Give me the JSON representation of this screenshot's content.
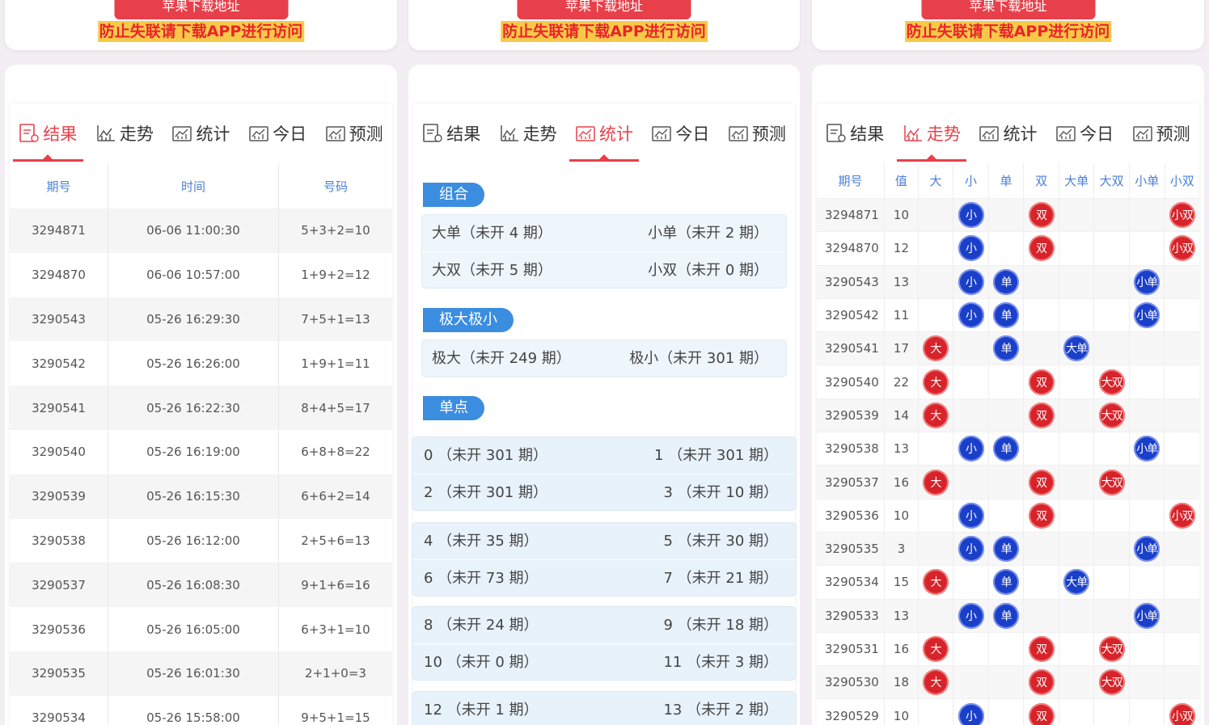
{
  "banner": {
    "apple_label": "苹果下载地址",
    "warning": "防止失联请下载APP进行访问"
  },
  "tabs": [
    "结果",
    "走势",
    "统计",
    "今日",
    "预测"
  ],
  "tab_icons": [
    "result-icon",
    "trend-chart-icon",
    "stats-chart-icon",
    "today-chart-icon",
    "predict-chart-icon"
  ],
  "results": {
    "headers": [
      "期号",
      "时间",
      "号码"
    ],
    "rows": [
      [
        "3294871",
        "06-06 11:00:30",
        "5+3+2=10"
      ],
      [
        "3294870",
        "06-06 10:57:00",
        "1+9+2=12"
      ],
      [
        "3290543",
        "05-26 16:29:30",
        "7+5+1=13"
      ],
      [
        "3290542",
        "05-26 16:26:00",
        "1+9+1=11"
      ],
      [
        "3290541",
        "05-26 16:22:30",
        "8+4+5=17"
      ],
      [
        "3290540",
        "05-26 16:19:00",
        "6+8+8=22"
      ],
      [
        "3290539",
        "05-26 16:15:30",
        "6+6+2=14"
      ],
      [
        "3290538",
        "05-26 16:12:00",
        "2+5+6=13"
      ],
      [
        "3290537",
        "05-26 16:08:30",
        "9+1+6=16"
      ],
      [
        "3290536",
        "05-26 16:05:00",
        "6+3+1=10"
      ],
      [
        "3290535",
        "05-26 16:01:30",
        "2+1+0=3"
      ],
      [
        "3290534",
        "05-26 15:58:00",
        "9+5+1=15"
      ]
    ]
  },
  "stats": {
    "combo_label": "组合",
    "combo": [
      [
        "大单（未开 4 期）",
        "小单（未开 2 期）"
      ],
      [
        "大双（未开 5 期）",
        "小双（未开 0 期）"
      ]
    ],
    "extreme_label": "极大极小",
    "extreme": [
      [
        "极大（未开 249 期）",
        "极小（未开 301 期）"
      ]
    ],
    "single_label": "单点",
    "single_groups": [
      [
        [
          "0 （未开 301 期）",
          "1 （未开 301 期）"
        ],
        [
          "2 （未开 301 期）",
          "3 （未开 10 期）"
        ]
      ],
      [
        [
          "4 （未开 35 期）",
          "5 （未开 30 期）"
        ],
        [
          "6 （未开 73 期）",
          "7 （未开 21 期）"
        ]
      ],
      [
        [
          "8 （未开 24 期）",
          "9 （未开 18 期）"
        ],
        [
          "10 （未开 0 期）",
          "11 （未开 3 期）"
        ]
      ],
      [
        [
          "12 （未开 1 期）",
          "13 （未开 2 期）"
        ]
      ]
    ]
  },
  "trend": {
    "headers": [
      "期号",
      "值",
      "大",
      "小",
      "单",
      "双",
      "大单",
      "大双",
      "小单",
      "小双"
    ],
    "colors": {
      "red": "#d8232a",
      "blue": "#1a3fc9"
    },
    "rows": [
      {
        "issue": "3294871",
        "value": "10",
        "cells": [
          "",
          "小",
          "",
          "双",
          "",
          "",
          "",
          "小双"
        ]
      },
      {
        "issue": "3294870",
        "value": "12",
        "cells": [
          "",
          "小",
          "",
          "双",
          "",
          "",
          "",
          "小双"
        ]
      },
      {
        "issue": "3290543",
        "value": "13",
        "cells": [
          "",
          "小",
          "单",
          "",
          "",
          "",
          "小单",
          ""
        ]
      },
      {
        "issue": "3290542",
        "value": "11",
        "cells": [
          "",
          "小",
          "单",
          "",
          "",
          "",
          "小单",
          ""
        ]
      },
      {
        "issue": "3290541",
        "value": "17",
        "cells": [
          "大",
          "",
          "单",
          "",
          "大单",
          "",
          "",
          ""
        ]
      },
      {
        "issue": "3290540",
        "value": "22",
        "cells": [
          "大",
          "",
          "",
          "双",
          "",
          "大双",
          "",
          ""
        ]
      },
      {
        "issue": "3290539",
        "value": "14",
        "cells": [
          "大",
          "",
          "",
          "双",
          "",
          "大双",
          "",
          ""
        ]
      },
      {
        "issue": "3290538",
        "value": "13",
        "cells": [
          "",
          "小",
          "单",
          "",
          "",
          "",
          "小单",
          ""
        ]
      },
      {
        "issue": "3290537",
        "value": "16",
        "cells": [
          "大",
          "",
          "",
          "双",
          "",
          "大双",
          "",
          ""
        ]
      },
      {
        "issue": "3290536",
        "value": "10",
        "cells": [
          "",
          "小",
          "",
          "双",
          "",
          "",
          "",
          "小双"
        ]
      },
      {
        "issue": "3290535",
        "value": "3",
        "cells": [
          "",
          "小",
          "单",
          "",
          "",
          "",
          "小单",
          ""
        ]
      },
      {
        "issue": "3290534",
        "value": "15",
        "cells": [
          "大",
          "",
          "单",
          "",
          "大单",
          "",
          "",
          ""
        ]
      },
      {
        "issue": "3290533",
        "value": "13",
        "cells": [
          "",
          "小",
          "单",
          "",
          "",
          "",
          "小单",
          ""
        ]
      },
      {
        "issue": "3290531",
        "value": "16",
        "cells": [
          "大",
          "",
          "",
          "双",
          "",
          "大双",
          "",
          ""
        ]
      },
      {
        "issue": "3290530",
        "value": "18",
        "cells": [
          "大",
          "",
          "",
          "双",
          "",
          "大双",
          "",
          ""
        ]
      },
      {
        "issue": "3290529",
        "value": "10",
        "cells": [
          "",
          "小",
          "",
          "双",
          "",
          "",
          "",
          "小双"
        ]
      }
    ]
  }
}
